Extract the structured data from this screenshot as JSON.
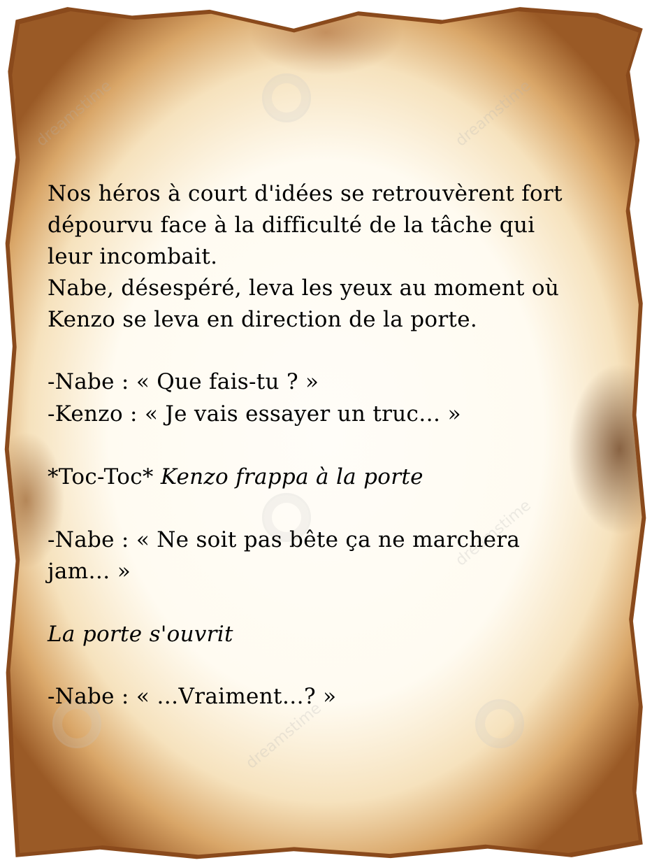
{
  "watermark": "dreamstime",
  "story": {
    "lines": [
      "Nos héros à court d'idées se retrouvèrent fort",
      "dépourvu face à la difficulté de la tâche qui",
      "leur incombait.",
      "Nabe, désespéré, leva les yeux au moment où",
      "Kenzo se leva en direction de la porte.",
      "-Nabe : « Que fais-tu ? »",
      "-Kenzo : « Je vais essayer un truc… »",
      "*Toc-Toc*",
      "Kenzo frappa à la porte",
      "-Nabe : « Ne soit pas bête ça ne marchera",
      "jam… »",
      "La porte s'ouvrit",
      "-Nabe : « …Vraiment…? »"
    ]
  },
  "colors": {
    "ink": "#000000",
    "parchment": "#fffbf1",
    "burn": "#8a4a1c"
  }
}
